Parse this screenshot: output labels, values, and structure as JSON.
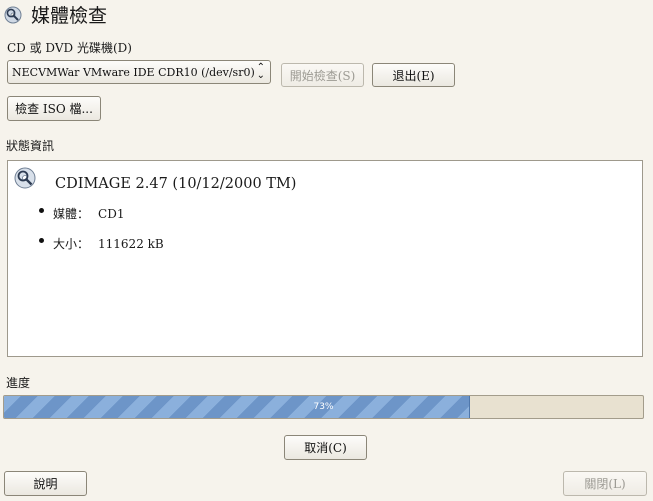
{
  "window": {
    "title": "媒體檢查",
    "icon": "media-check-icon"
  },
  "drive": {
    "label": "CD 或 DVD 光碟機(D)",
    "selected": "NECVMWar VMware IDE CDR10 (/dev/sr0)"
  },
  "buttons": {
    "start": "開始檢查(S)",
    "eject": "退出(E)",
    "check_iso": "檢查 ISO 檔...",
    "cancel": "取消(C)",
    "help": "說明",
    "close": "關閉(L)"
  },
  "status": {
    "label": "狀態資訊",
    "icon": "cd-check-icon",
    "title": "CDIMAGE 2.47 (10/12/2000 TM)",
    "items": [
      {
        "key": "媒體：",
        "value": "CD1"
      },
      {
        "key": "大小：",
        "value": "111622 kB"
      }
    ]
  },
  "progress": {
    "label": "進度",
    "percent": 73,
    "text": "73%"
  },
  "colors": {
    "window_bg": "#f6f3ec",
    "progress_fill": "#7ba2d4",
    "progress_track": "#e8e1d0"
  }
}
